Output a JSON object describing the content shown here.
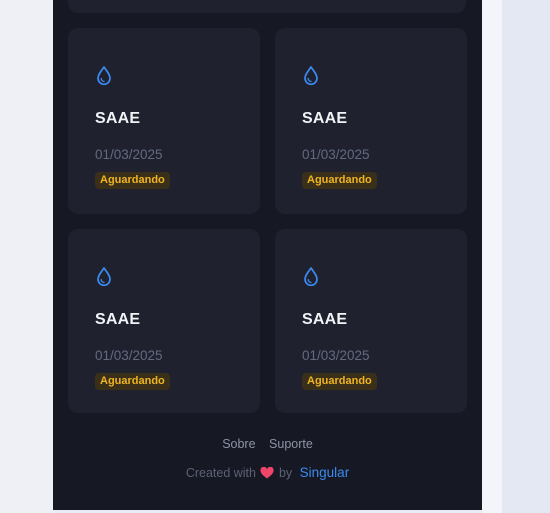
{
  "cards": [
    {
      "icon": "water-drop-icon",
      "title": "SAAE",
      "date": "01/03/2025",
      "status": "Aguardando"
    },
    {
      "icon": "water-drop-icon",
      "title": "SAAE",
      "date": "01/03/2025",
      "status": "Aguardando"
    },
    {
      "icon": "water-drop-icon",
      "title": "SAAE",
      "date": "01/03/2025",
      "status": "Aguardando"
    },
    {
      "icon": "water-drop-icon",
      "title": "SAAE",
      "date": "01/03/2025",
      "status": "Aguardando"
    }
  ],
  "footer": {
    "links": [
      "Sobre",
      "Suporte"
    ],
    "credit_prefix": "Created with",
    "credit_by": "by",
    "brand": "Singular"
  },
  "colors": {
    "background": "#161823",
    "card": "#1f212e",
    "accent": "#3b8bf0",
    "status_pending": "#f0b423",
    "heart": "#f0456b"
  }
}
